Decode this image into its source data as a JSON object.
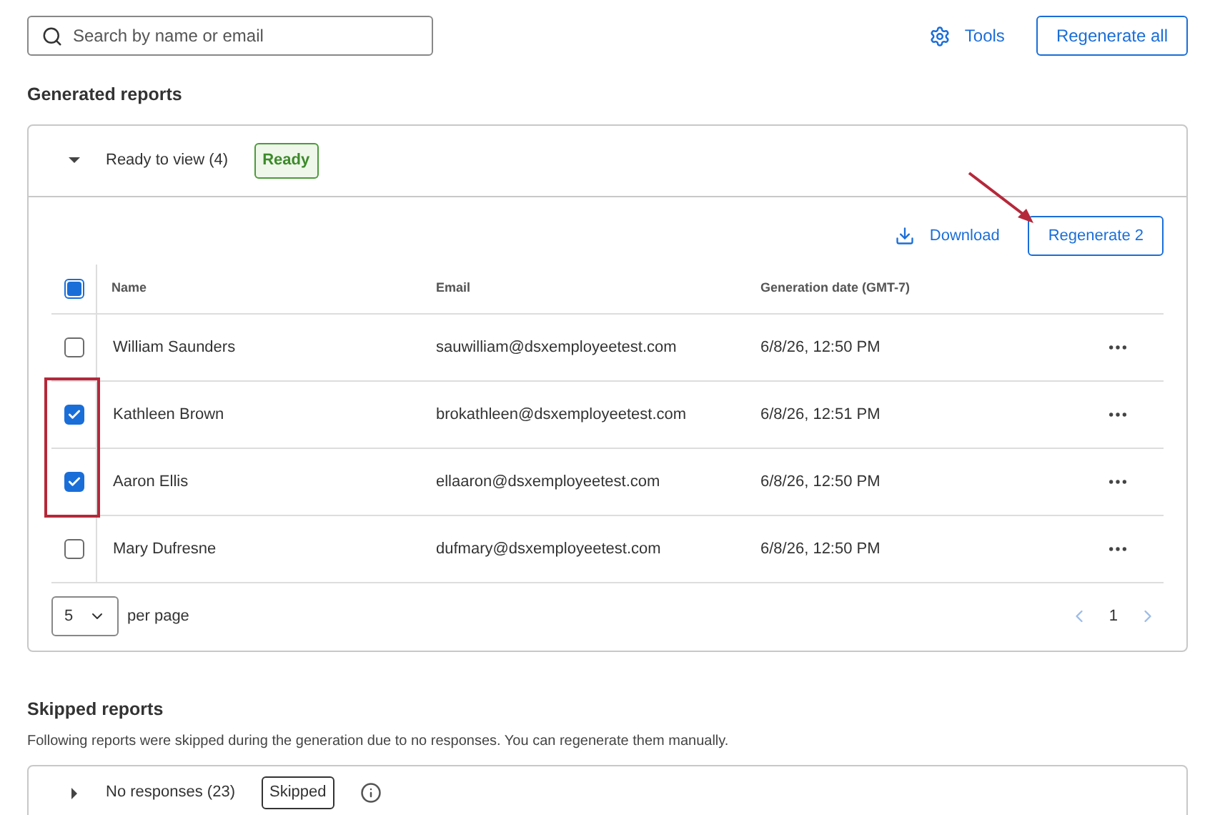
{
  "search": {
    "placeholder": "Search by name or email"
  },
  "toolbar": {
    "tools": "Tools",
    "regenerate_all": "Regenerate all"
  },
  "generated": {
    "title": "Generated reports",
    "group": {
      "label": "Ready to view (4)",
      "expanded": true,
      "badge": "Ready"
    },
    "actions": {
      "download": "Download",
      "regenerate": "Regenerate 2"
    },
    "table": {
      "select_all_indeterminate": true,
      "columns": [
        "Name",
        "Email",
        "Generation date (GMT-7)"
      ],
      "rows": [
        {
          "name": "William Saunders",
          "email": "sauwilliam@dsxemployeetest.com",
          "date": "6/8/26, 12:50 PM",
          "checked": false
        },
        {
          "name": "Kathleen Brown",
          "email": "brokathleen@dsxemployeetest.com",
          "date": "6/8/26, 12:51 PM",
          "checked": true
        },
        {
          "name": "Aaron Ellis",
          "email": "ellaaron@dsxemployeetest.com",
          "date": "6/8/26, 12:50 PM",
          "checked": true
        },
        {
          "name": "Mary Dufresne",
          "email": "dufmary@dsxemployeetest.com",
          "date": "6/8/26, 12:50 PM",
          "checked": false
        }
      ]
    },
    "pagination": {
      "page_size": "5",
      "per_page": "per page",
      "page": "1"
    }
  },
  "skipped": {
    "title": "Skipped reports",
    "description": "Following reports were skipped during the generation due to no responses. You can regenerate them manually.",
    "group": {
      "label": "No responses (23)",
      "expanded": false,
      "badge": "Skipped"
    }
  }
}
